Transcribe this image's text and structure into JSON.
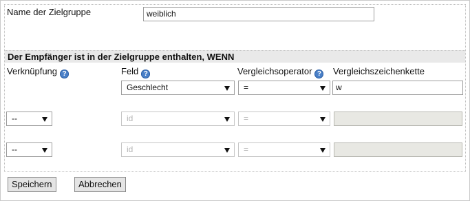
{
  "group_name": {
    "label": "Name der Zielgruppe",
    "value": "weiblich"
  },
  "condition_header": "Der Empfänger ist in der Zielgruppe enthalten, WENN",
  "columns": {
    "link": "Verknüpfung",
    "field": "Feld",
    "operator": "Vergleichsoperator",
    "compare_string": "Vergleichszeichenkette"
  },
  "help_glyph": "?",
  "rows": [
    {
      "field": "Geschlecht",
      "operator": "=",
      "value": "w"
    },
    {
      "link": "--",
      "field": "id",
      "operator": "=",
      "value": ""
    },
    {
      "link": "--",
      "field": "id",
      "operator": "=",
      "value": ""
    }
  ],
  "buttons": {
    "save": "Speichern",
    "cancel": "Abbrechen"
  },
  "colors": {
    "help_icon": "#4a80c8",
    "header_bar": "#e9e9e9",
    "disabled_input": "#e8e8e3"
  }
}
